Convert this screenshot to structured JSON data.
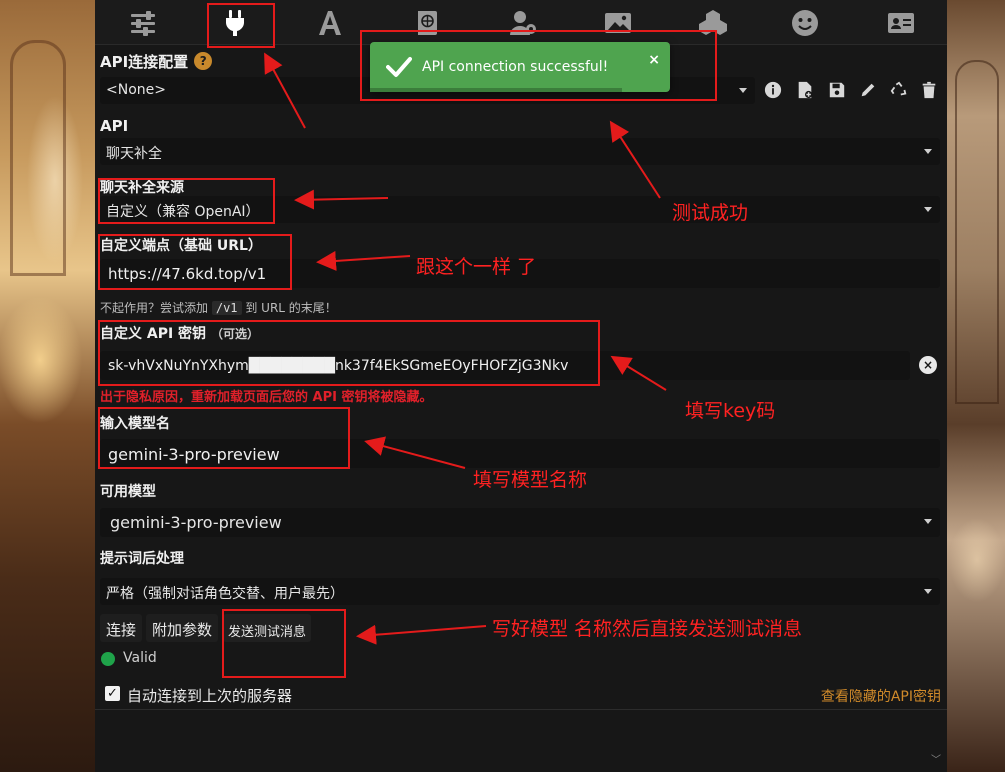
{
  "config": {
    "title": "API连接配置",
    "help_glyph": "?",
    "profile_value": "<None>"
  },
  "api": {
    "label": "API",
    "value": "聊天补全"
  },
  "source": {
    "label": "聊天补全来源",
    "value": "自定义（兼容 OpenAI）"
  },
  "endpoint": {
    "label": "自定义端点（基础 URL）",
    "value": "https://47.6kd.top/v1",
    "hint_before": "不起作用？尝试添加",
    "hint_code": "/v1",
    "hint_after": "到 URL 的末尾！"
  },
  "apikey": {
    "label": "自定义 API 密钥",
    "optional": "（可选）",
    "value": "sk-vhVxNuYnYXhym████████nk37f4EkSGmeEOyFHOFZjG3Nkv",
    "warning": "出于隐私原因，重新加载页面后您的 API 密钥将被隐藏。"
  },
  "model_input": {
    "label": "输入模型名",
    "value": "gemini-3-pro-preview"
  },
  "available_models": {
    "label": "可用模型",
    "value": "gemini-3-pro-preview"
  },
  "prompt_post": {
    "label": "提示词后处理",
    "value": "严格（强制对话角色交替、用户最先）"
  },
  "buttons": {
    "connect": "连接",
    "extra_params": "附加参数",
    "send_test": "发送测试消息"
  },
  "status": {
    "text": "Valid",
    "color": "#1fa34a"
  },
  "auto_connect": {
    "label": "自动连接到上次的服务器",
    "checked": true,
    "check_glyph": "✓"
  },
  "view_hidden_keys": "查看隐藏的API密钥",
  "toast": {
    "message": "API connection successful!",
    "close_glyph": "×"
  },
  "top_icons": [
    "sliders-icon",
    "plug-icon",
    "font-icon",
    "book-icon",
    "user-gear-icon",
    "image-icon",
    "cubes-icon",
    "smiley-icon",
    "id-card-icon"
  ],
  "annotations": {
    "success": "测试成功",
    "same_as_this": "跟这个一样 了",
    "fill_key": "填写key码",
    "fill_model": "填写模型名称",
    "send_test_note": "写好模型 名称然后直接发送测试消息"
  },
  "colors": {
    "accent_orange": "#d08a2a",
    "toast_green": "#4fa44f",
    "annotation_red": "#e41b1b",
    "warning_red": "#e0202a"
  }
}
